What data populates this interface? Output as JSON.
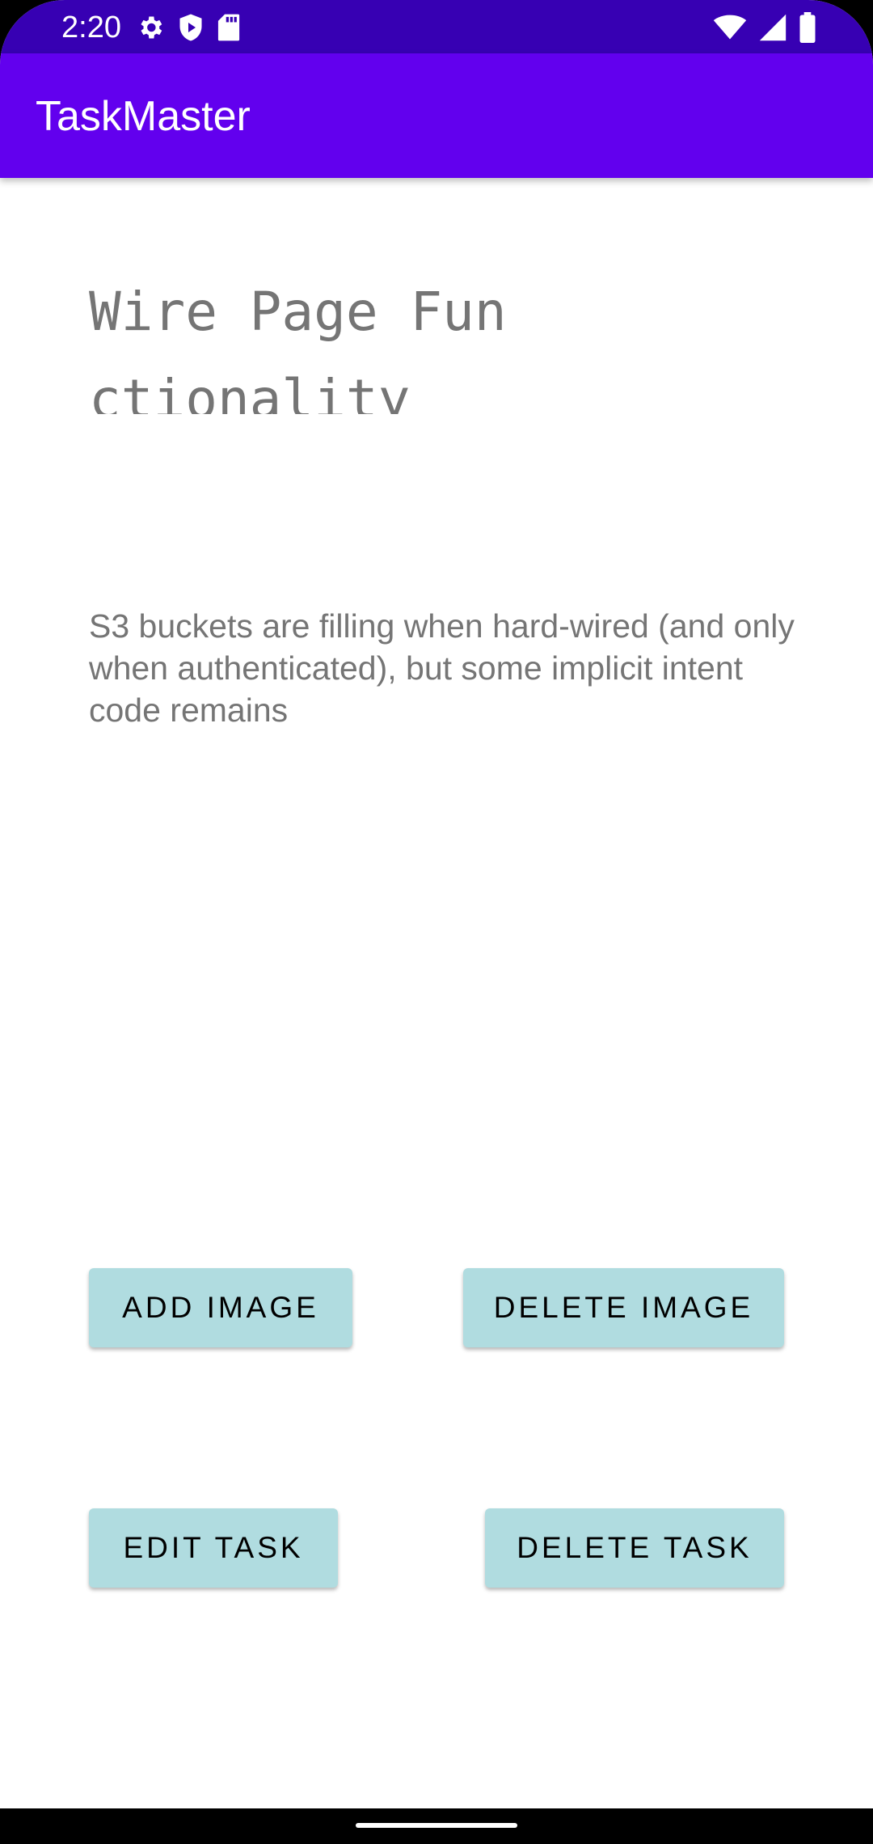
{
  "status_bar": {
    "time": "2:20",
    "left_icons": [
      "gear-icon",
      "shield-play-icon",
      "sd-card-icon"
    ],
    "right_icons": [
      "wifi-icon",
      "cell-signal-icon",
      "battery-icon"
    ],
    "color": "#3700B3"
  },
  "app_bar": {
    "title": "TaskMaster",
    "color": "#6200EE"
  },
  "task": {
    "title": "Wire Page Functionality",
    "body": "S3 buckets are filling when hard-wired (and only when authenticated), but some implicit intent code remains"
  },
  "buttons": {
    "add_image": "ADD IMAGE",
    "delete_image": "DELETE IMAGE",
    "edit_task": "EDIT TASK",
    "delete_task": "DELETE TASK",
    "color": "#B0DCE0"
  }
}
